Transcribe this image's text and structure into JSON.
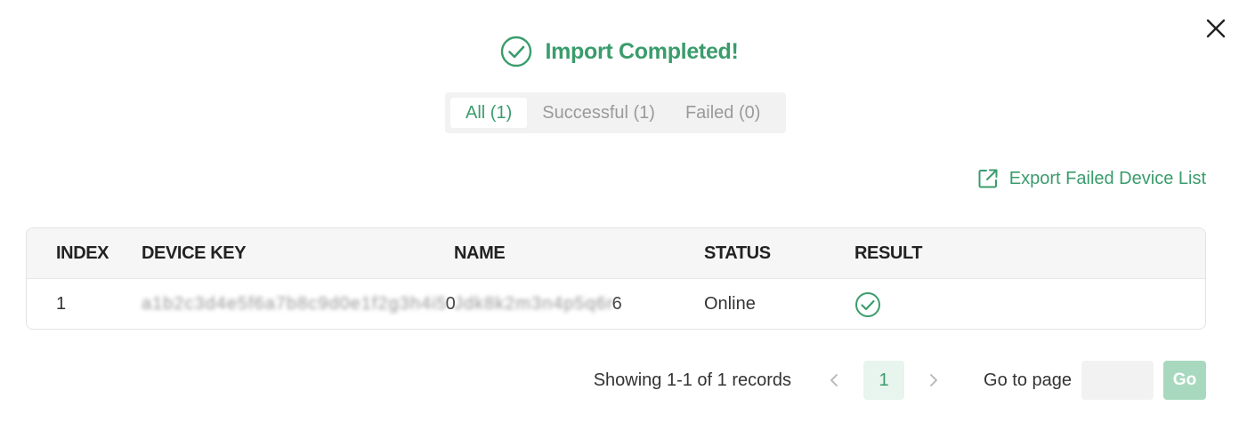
{
  "dialog": {
    "title": "Import Completed!",
    "accent_color": "#3a9c6c",
    "close_icon": "close-icon",
    "title_icon": "check-circle-icon"
  },
  "tabs": [
    {
      "label": "All (1)",
      "active": true
    },
    {
      "label": "Successful (1)",
      "active": false
    },
    {
      "label": "Failed (0)",
      "active": false
    }
  ],
  "export": {
    "label": "Export Failed Device List",
    "icon": "external-link-icon"
  },
  "table": {
    "columns": [
      "INDEX",
      "DEVICE KEY",
      "NAME",
      "STATUS",
      "RESULT"
    ],
    "rows": [
      {
        "index": "1",
        "device_key_blurred": "a1b2c3d4e5f6a7b8c9d0e1f2g3h4i5",
        "device_key_tail": "0",
        "name_blurred": "Jdk8k2m3n4p5q6r",
        "name_tail": "6",
        "status": "Online",
        "result_icon": "check-circle-icon"
      }
    ]
  },
  "pagination": {
    "summary": "Showing 1-1 of 1 records",
    "prev_icon": "chevron-left-icon",
    "next_icon": "chevron-right-icon",
    "current_page": "1",
    "goto_label": "Go to page",
    "goto_value": "",
    "go_label": "Go"
  }
}
